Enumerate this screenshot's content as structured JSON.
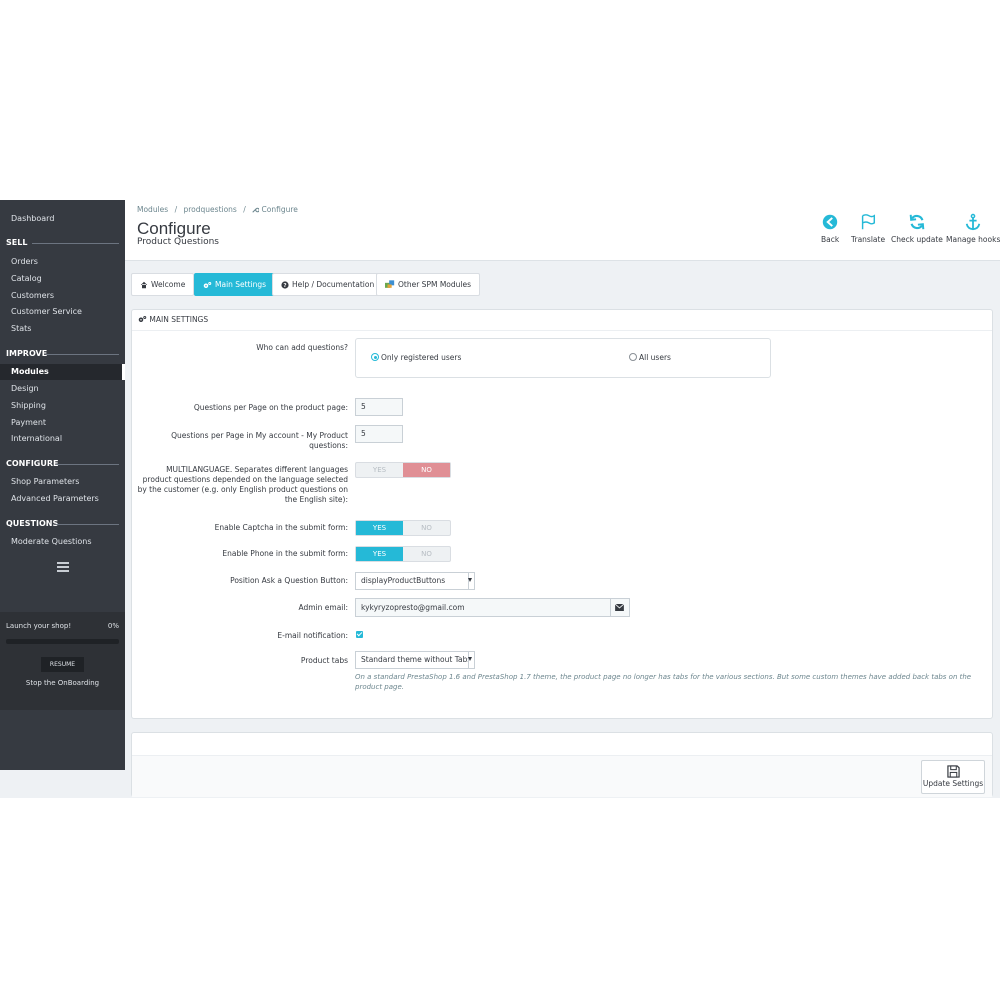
{
  "sidebar": {
    "dashboard": "Dashboard",
    "sections": [
      {
        "title": "SELL",
        "items": [
          "Orders",
          "Catalog",
          "Customers",
          "Customer Service",
          "Stats"
        ]
      },
      {
        "title": "IMPROVE",
        "items": [
          "Modules",
          "Design",
          "Shipping",
          "Payment",
          "International"
        ]
      },
      {
        "title": "CONFIGURE",
        "items": [
          "Shop Parameters",
          "Advanced Parameters"
        ]
      },
      {
        "title": "QUESTIONS",
        "items": [
          "Moderate Questions"
        ]
      }
    ],
    "active_item": "Modules",
    "onboarding": {
      "launch": "Launch your shop!",
      "percent": "0%",
      "progress": 0,
      "resume": "RESUME",
      "stop": "Stop the OnBoarding"
    }
  },
  "header": {
    "breadcrumb": [
      "Modules",
      "prodquestions",
      "Configure"
    ],
    "title": "Configure",
    "subtitle": "Product Questions",
    "toolbar": [
      {
        "label": "Back",
        "icon": "back-arrow-icon"
      },
      {
        "label": "Translate",
        "icon": "flag-icon"
      },
      {
        "label": "Check update",
        "icon": "refresh-icon"
      },
      {
        "label": "Manage hooks",
        "icon": "anchor-icon"
      }
    ]
  },
  "tabs": [
    {
      "label": "Welcome",
      "icon": "home-icon",
      "active": false
    },
    {
      "label": "Main Settings",
      "icon": "gears-icon",
      "active": true
    },
    {
      "label": "Help / Documentation",
      "icon": "question-icon",
      "active": false
    },
    {
      "label": "Other SPM Modules",
      "icon": "puzzle-icon",
      "active": false
    }
  ],
  "form": {
    "heading": "MAIN SETTINGS",
    "who_label": "Who can add questions?",
    "who_options": [
      "Only registered users",
      "All users"
    ],
    "who_selected": "Only registered users",
    "per_page_label": "Questions per Page on the product page:",
    "per_page_value": "5",
    "per_account_label_1": "Questions per Page in My account - My Product",
    "per_account_label_2": "questions:",
    "per_account_value": "5",
    "multilang_label": [
      "MULTILANGUAGE. Separates different languages",
      "product questions depended on the language selected",
      "by the customer (e.g. only English product questions on",
      "the English site):"
    ],
    "multilang_value": "NO",
    "captcha_label": "Enable Captcha in the submit form:",
    "captcha_value": "YES",
    "phone_label": "Enable Phone in the submit form:",
    "phone_value": "YES",
    "yes": "YES",
    "no": "NO",
    "position_label": "Position Ask a Question Button:",
    "position_value": "displayProductButtons",
    "admin_email_label": "Admin email:",
    "admin_email_value": "kykyryzopresto@gmail.com",
    "notification_label": "E-mail notification:",
    "notification_checked": true,
    "product_tabs_label": "Product tabs",
    "product_tabs_value": "Standard theme without Tabs",
    "product_tabs_help": "On a standard PrestaShop 1.6 and PrestaShop 1.7 theme, the product page no longer has tabs for the various sections. But some custom themes have added back tabs on the product page."
  },
  "footer": {
    "update_label": "Update Settings"
  },
  "colors": {
    "accent": "#25b9d7",
    "danger": "#e08f95",
    "sidebar": "#363a41"
  }
}
